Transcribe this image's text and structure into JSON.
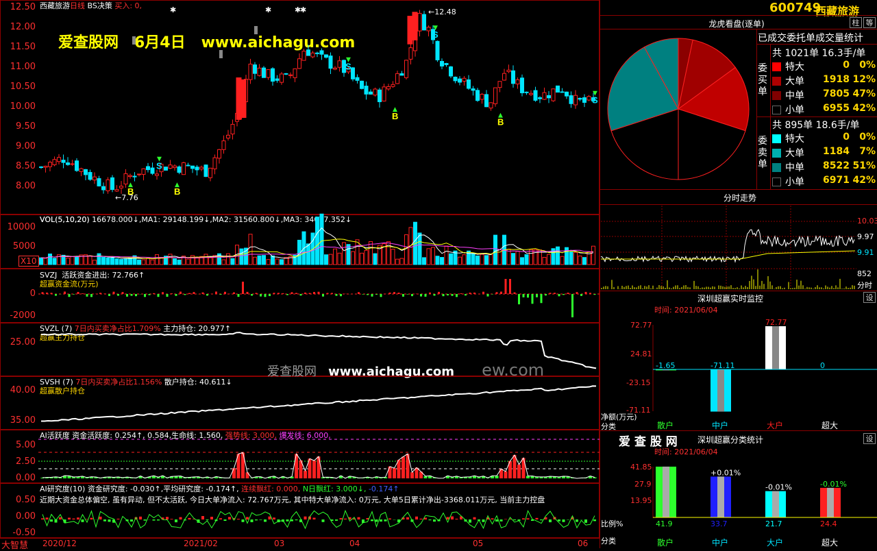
{
  "stock": {
    "code": "600749",
    "name": "西藏旅游",
    "period": "日线",
    "strategy": "BS决策",
    "buy_label": "买入: 0,"
  },
  "watermark": {
    "site_name": "爱查股网",
    "date": "6月4日",
    "url": "www.aichagu.com",
    "mid_site": "爱查股网",
    "mid_url": "www.aichagu.com",
    "mid_tail": "ew.com"
  },
  "main_chart": {
    "y_ticks": [
      "12.50",
      "12.00",
      "11.50",
      "11.00",
      "10.50",
      "10.00",
      "9.50",
      "9.00",
      "8.50",
      "8.00"
    ],
    "high_label": "12.48",
    "low_label": "7.76",
    "markers": [
      "B",
      "B",
      "S",
      "S",
      "B",
      "S",
      "B",
      "S",
      "S"
    ]
  },
  "vol_panel": {
    "header": "VOL(5,10,20)  16678.000↓,MA1: 29148.199↓,MA2: 31560.800↓,MA3: 34077.352↓",
    "y_ticks": [
      "10000",
      "5000"
    ],
    "unit": "X10"
  },
  "svzj_panel": {
    "header_name": "SVZJ",
    "header_text": "活跃资金进出: 72.766↑",
    "sub_label": "超赢资金流(万元)",
    "y_ticks": [
      "0",
      "-2000"
    ]
  },
  "svzl_panel": {
    "header_name": "SVZL (7)",
    "header_red": "7日内买卖净占比1.709%",
    "header_text": "主力持仓: 20.977↑",
    "sub_label": "超赢主力持仓",
    "y_ticks": [
      "25.00"
    ]
  },
  "svsh_panel": {
    "header_name": "SVSH (7)",
    "header_red": "7日内买卖净占比1.156%",
    "header_text": "散户持仓: 40.611↓",
    "sub_label": "超赢散户持仓",
    "y_ticks": [
      "40.00",
      "35.00"
    ]
  },
  "ai_panel": {
    "header_a": "AI活跃度  资金活跃度: 0.254↑, 0.584,生命线: 1.560,",
    "header_strong": "强势线: 3.000,",
    "header_burst": "爆发线: 6.000,",
    "y_ticks": [
      "5.00",
      "2.50",
      "0.00"
    ]
  },
  "ai_research": {
    "header_a": "AI研究度(10)  资金研究度: -0.030↑,平均研究度: -0.174↑,",
    "header_red": "连续飘红: 0.000,",
    "header_n": "N日飘红: 3.000↓,",
    "header_tail": "-0.174↑",
    "comment": "近期大资金总体偏空, 虽有异动, 但不太活跃, 今日大单净流入: 72.767万元, 其中特大单净流入: 0万元, 大单5日累计净出-3368.011万元, 当前主力控盘",
    "y_ticks": [
      "0.50",
      "0.00",
      "-0.50"
    ]
  },
  "x_axis": {
    "brand": "大智慧",
    "labels": [
      "2020/12",
      "2021/02",
      "03",
      "04",
      "05",
      "06"
    ]
  },
  "right": {
    "code": "600749",
    "name": "西藏旅游",
    "btn_a": "柱",
    "btn_b": "等",
    "dragon_title": "龙虎看盘(逐单)",
    "stat_title": "已成交委托单成交量统计",
    "buy": {
      "side": "委买单",
      "total": "共 1021单 16.3手/单",
      "rows": [
        {
          "label": "特大",
          "count": "0",
          "pct": "0%",
          "color": "#ff0000"
        },
        {
          "label": "大单",
          "count": "1918",
          "pct": "12%",
          "color": "#b00000"
        },
        {
          "label": "中单",
          "count": "7805",
          "pct": "47%",
          "color": "#800000"
        },
        {
          "label": "小单",
          "count": "6955",
          "pct": "42%",
          "color": "#000000"
        }
      ]
    },
    "sell": {
      "side": "委卖单",
      "total": "共 895单 18.6手/单",
      "rows": [
        {
          "label": "特大",
          "count": "0",
          "pct": "0%",
          "color": "#00ffff"
        },
        {
          "label": "大单",
          "count": "1184",
          "pct": "7%",
          "color": "#00b0b0"
        },
        {
          "label": "中单",
          "count": "8522",
          "pct": "51%",
          "color": "#008080"
        },
        {
          "label": "小单",
          "count": "6971",
          "pct": "42%",
          "color": "#000000"
        }
      ]
    },
    "intraday": {
      "title": "分时走势",
      "y_ticks": [
        "10.03",
        "9.97",
        "9.91",
        "852"
      ],
      "vol_label": "分时"
    },
    "monitor": {
      "title": "深圳超赢实时监控",
      "btn": "设",
      "time": "时间: 2021/06/04",
      "y_ticks": [
        "72.77",
        "24.81",
        "-23.15",
        "-71.11"
      ],
      "unit": "净额(万元)",
      "cat_label": "分类",
      "categories": [
        "散户",
        "中户",
        "大户",
        "超大"
      ],
      "values": [
        -1.65,
        -71.11,
        72.77,
        0
      ],
      "value_labels": [
        "-1.65",
        "-71.11",
        "72.77",
        "0"
      ]
    },
    "classify": {
      "title": "深圳超赢分类统计",
      "btn": "设",
      "brand": "爱 查 股 网",
      "time": "时间: 2021/06/04",
      "y_ticks": [
        "41.85",
        "27.9",
        "13.95"
      ],
      "unit": "比例%",
      "cat_label": "分类",
      "categories": [
        "散户",
        "中户",
        "大户",
        "超大"
      ],
      "values": [
        41.9,
        33.7,
        21.7,
        24.4
      ],
      "value_labels": [
        "41.9",
        "33.7",
        "21.7",
        "24.4"
      ],
      "changes": [
        "",
        "+0.01%",
        "-0.01%",
        "-0.01%"
      ],
      "colors": [
        "#2dff2d",
        "#2020ff",
        "#00ffff",
        "#ff2020"
      ]
    }
  }
}
